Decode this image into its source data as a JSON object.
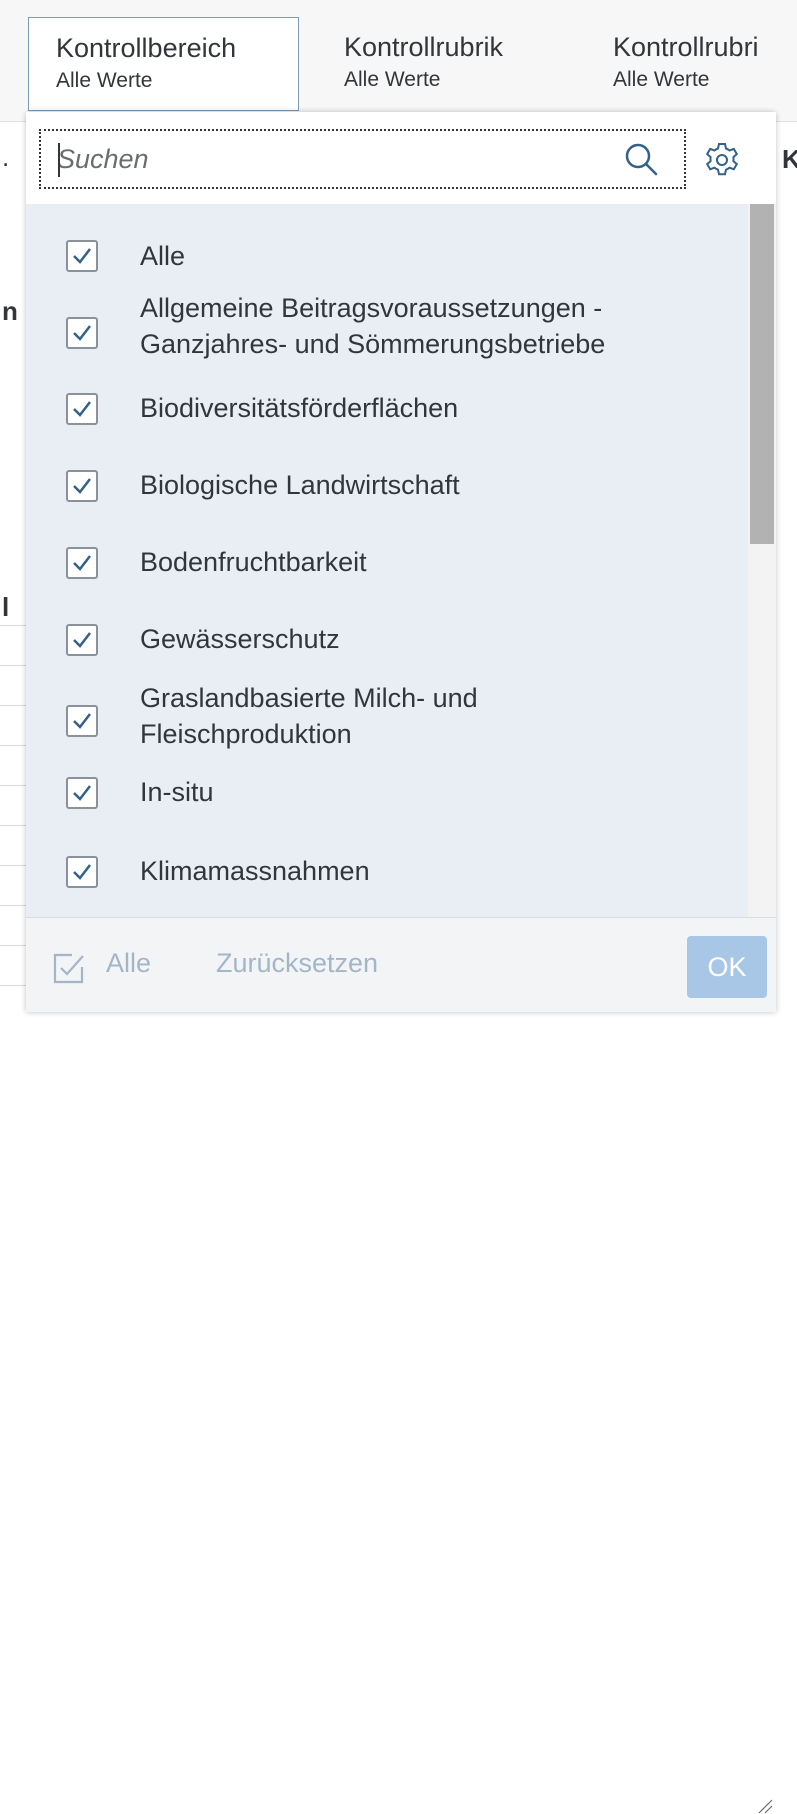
{
  "filter_bar": {
    "tabs": [
      {
        "title": "Kontrollbereich",
        "value": "Alle Werte"
      },
      {
        "title": "Kontrollrubrik",
        "value": "Alle Werte"
      },
      {
        "title": "Kontrollrubri",
        "value": "Alle Werte"
      }
    ]
  },
  "background": {
    "fragments": [
      ".",
      "K",
      "n",
      "l"
    ]
  },
  "popover": {
    "search": {
      "placeholder": "Suchen"
    },
    "items": [
      {
        "label_lines": [
          "Alle"
        ],
        "checked": true
      },
      {
        "label_lines": [
          "Allgemeine Beitragsvoraussetzungen -",
          "Ganzjahres- und Sömmerungsbetriebe"
        ],
        "checked": true
      },
      {
        "label_lines": [
          "Biodiversitätsförderflächen"
        ],
        "checked": true
      },
      {
        "label_lines": [
          "Biologische Landwirtschaft"
        ],
        "checked": true
      },
      {
        "label_lines": [
          "Bodenfruchtbarkeit"
        ],
        "checked": true
      },
      {
        "label_lines": [
          "Gewässerschutz"
        ],
        "checked": true
      },
      {
        "label_lines": [
          "Graslandbasierte Milch- und",
          "Fleischproduktion"
        ],
        "checked": true
      },
      {
        "label_lines": [
          "In-situ"
        ],
        "checked": true
      },
      {
        "label_lines": [
          "Klimamassnahmen"
        ],
        "checked": true
      }
    ],
    "footer": {
      "select_all_label": "Alle",
      "reset_label": "Zurücksetzen",
      "ok_label": "OK"
    }
  },
  "colors": {
    "list_background": "#e9eef5",
    "checkbox_check": "#346187",
    "ok_button": "#a8c6e6",
    "footer_text": "#a3b6c9"
  }
}
